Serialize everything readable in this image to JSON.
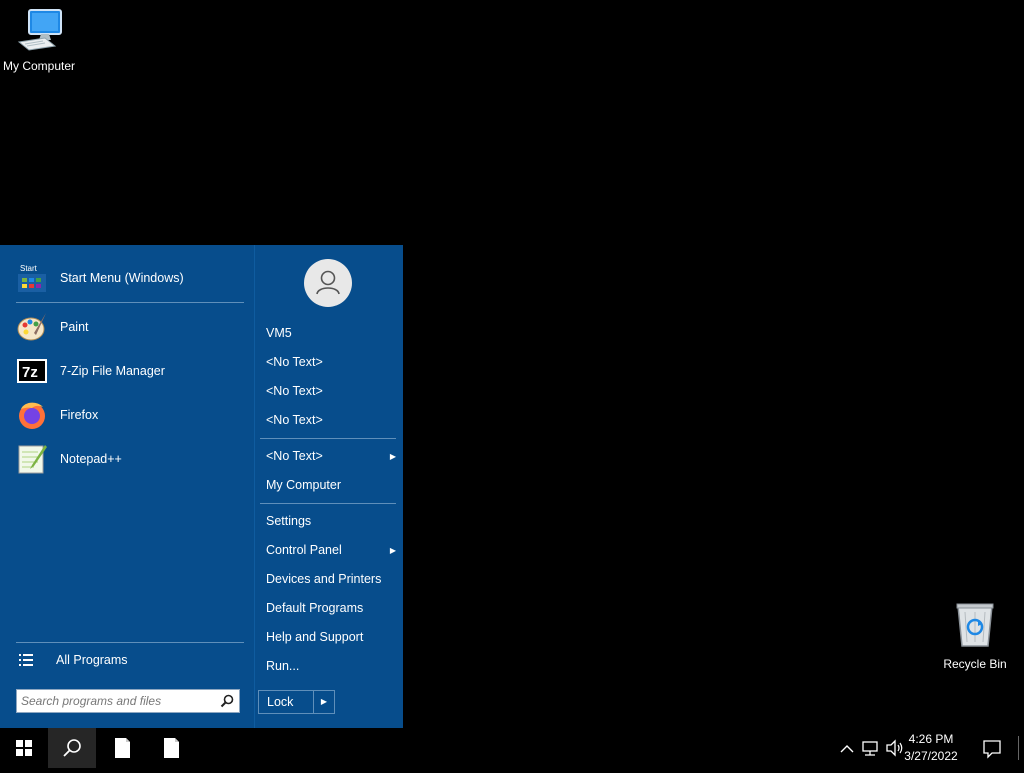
{
  "desktop": {
    "icons": [
      {
        "label": "My Computer"
      },
      {
        "label": "Recycle Bin"
      }
    ]
  },
  "start_menu": {
    "pinned": [
      {
        "label": "Start Menu (Windows)",
        "icon": "start-menu-icon"
      },
      {
        "label": "Paint",
        "icon": "paint-icon"
      },
      {
        "label": "7-Zip File Manager",
        "icon": "7zip-icon"
      },
      {
        "label": "Firefox",
        "icon": "firefox-icon"
      },
      {
        "label": "Notepad++",
        "icon": "notepadpp-icon"
      }
    ],
    "start_icon_text": "Start",
    "sevenzip_icon_text": "7z",
    "all_programs": "All Programs",
    "search_placeholder": "Search programs and files",
    "user_name": "VM5",
    "right_items": [
      {
        "label": "<No Text>"
      },
      {
        "label": "<No Text>"
      },
      {
        "label": "<No Text>"
      },
      {
        "label": "<No Text>",
        "submenu": true
      },
      {
        "label": "My Computer"
      },
      {
        "label": "Settings"
      },
      {
        "label": "Control Panel",
        "submenu": true
      },
      {
        "label": "Devices and Printers"
      },
      {
        "label": "Default Programs"
      },
      {
        "label": "Help and Support"
      },
      {
        "label": "Run..."
      }
    ],
    "submenu_arrow": "▶",
    "lock_label": "Lock"
  },
  "taskbar": {
    "time": "4:26 PM",
    "date": "3/27/2022",
    "colors": {
      "start_menu_bg": "#074d8c",
      "taskbar_bg": "#000000",
      "active_button_bg": "#262626"
    }
  }
}
